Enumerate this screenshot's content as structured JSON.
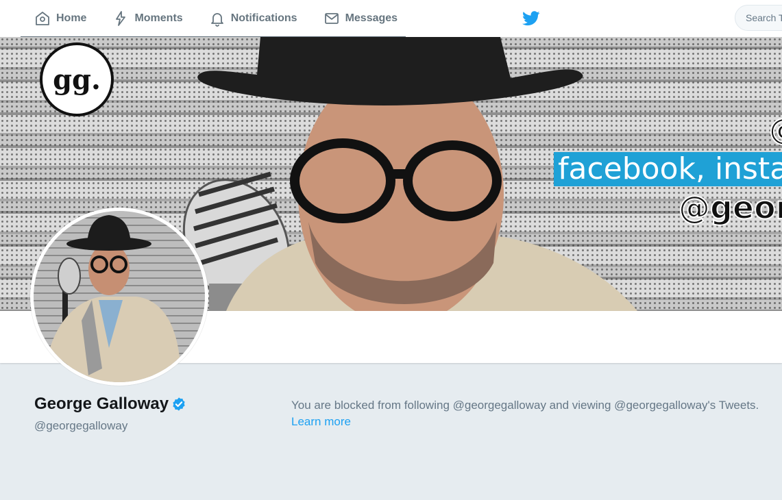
{
  "nav": {
    "home": "Home",
    "moments": "Moments",
    "notifications": "Notifications",
    "messages": "Messages"
  },
  "search": {
    "placeholder": "Search Twitter"
  },
  "banner": {
    "logo_text": "gg.",
    "social_text": "facebook, instagram",
    "handle_text": "@georgegalloway",
    "partial_handle": "@"
  },
  "profile": {
    "name": "George Galloway",
    "screen_name": "@georgegalloway",
    "verified": true
  },
  "blocked": {
    "message": "You are blocked from following @georgegalloway and viewing @georgegalloway's Tweets.",
    "learn_more": "Learn more"
  },
  "colors": {
    "twitter_blue": "#1da1f2",
    "background": "#e6ecf0",
    "muted_text": "#657786"
  }
}
